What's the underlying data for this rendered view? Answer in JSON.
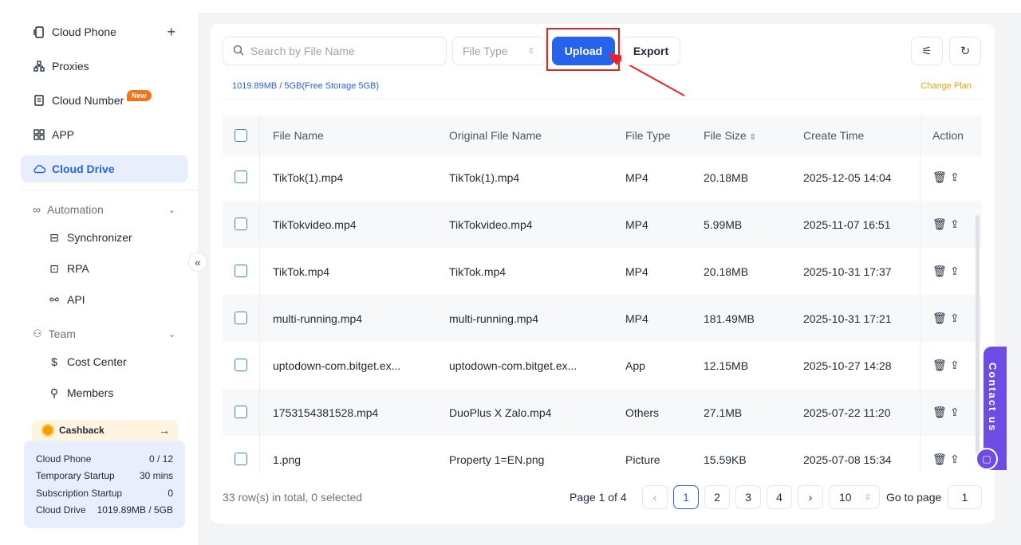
{
  "sidebar": {
    "cloud_phone": "Cloud Phone",
    "proxies": "Proxies",
    "cloud_number": "Cloud Number",
    "new_badge": "New",
    "app": "APP",
    "cloud_drive": "Cloud Drive",
    "automation": "Automation",
    "synchronizer": "Synchronizer",
    "rpa": "RPA",
    "api": "API",
    "team": "Team",
    "cost_center": "Cost Center",
    "members": "Members",
    "cashback": "Cashback",
    "stats": [
      {
        "label": "Cloud Phone",
        "value": "0 / 12"
      },
      {
        "label": "Temporary Startup",
        "value": "30 mins"
      },
      {
        "label": "Subscription Startup",
        "value": "0"
      },
      {
        "label": "Cloud Drive",
        "value": "1019.89MB / 5GB"
      }
    ]
  },
  "toolbar": {
    "search_placeholder": "Search by File Name",
    "file_type_placeholder": "File Type",
    "upload": "Upload",
    "export": "Export"
  },
  "storage": {
    "usage": "1019.89MB / 5GB(Free Storage 5GB)",
    "change_plan": "Change Plan"
  },
  "table": {
    "headers": {
      "file_name": "File Name",
      "original_file_name": "Original File Name",
      "file_type": "File Type",
      "file_size": "File Size",
      "create_time": "Create Time",
      "action": "Action"
    },
    "rows": [
      {
        "name": "TikTok(1).mp4",
        "original": "TikTok(1).mp4",
        "type": "MP4",
        "size": "20.18MB",
        "time": "2025-12-05 14:04"
      },
      {
        "name": "TikTokvideo.mp4",
        "original": "TikTokvideo.mp4",
        "type": "MP4",
        "size": "5.99MB",
        "time": "2025-11-07 16:51"
      },
      {
        "name": "TikTok.mp4",
        "original": "TikTok.mp4",
        "type": "MP4",
        "size": "20.18MB",
        "time": "2025-10-31 17:37"
      },
      {
        "name": "multi-running.mp4",
        "original": "multi-running.mp4",
        "type": "MP4",
        "size": "181.49MB",
        "time": "2025-10-31 17:21"
      },
      {
        "name": "uptodown-com.bitget.ex...",
        "original": "uptodown-com.bitget.ex...",
        "type": "App",
        "size": "12.15MB",
        "time": "2025-10-27 14:28"
      },
      {
        "name": "1753154381528.mp4",
        "original": "DuoPlus X Zalo.mp4",
        "type": "Others",
        "size": "27.1MB",
        "time": "2025-07-22 11:20"
      },
      {
        "name": "1.png",
        "original": "Property 1=EN.png",
        "type": "Picture",
        "size": "15.59KB",
        "time": "2025-07-08 15:34"
      }
    ]
  },
  "footer": {
    "total": "33 row(s) in total, 0 selected",
    "page_label": "Page 1 of 4",
    "pages": [
      "1",
      "2",
      "3",
      "4"
    ],
    "page_size": "10",
    "goto_label": "Go to page",
    "goto_value": "1"
  },
  "contact": "Contact us",
  "colors": {
    "accent": "#2563eb",
    "highlight": "#ef2020",
    "contact": "#6d4ce6",
    "change_plan": "#f59e0b"
  }
}
